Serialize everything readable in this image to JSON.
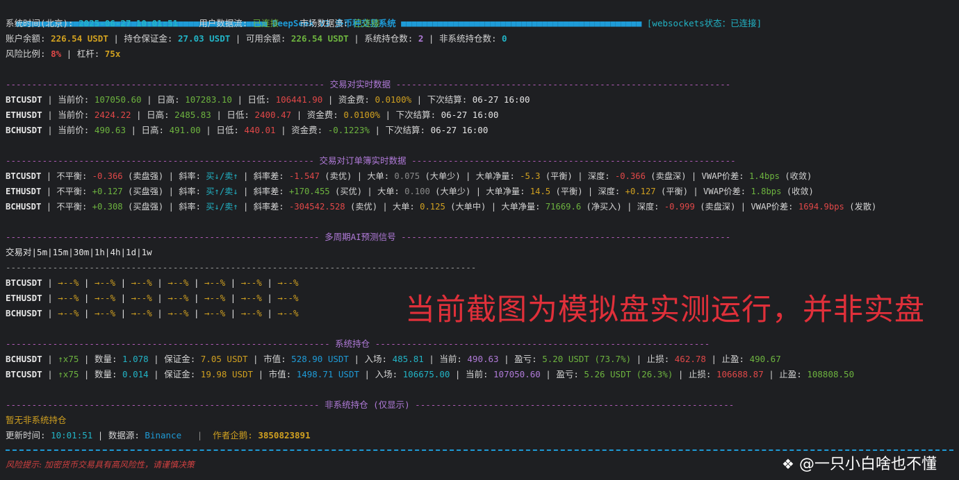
{
  "header": {
    "bar_left": "■■■■■■■■■■■■■■■■■■■■■■■■■■■■■■■■■■■■■■■■■■■■■■■■",
    "title": "DeepSeek V3 多币种交易系统",
    "bar_right": "■■■■■■■■■■■■■■■■■■■■■■■■■■■■■■■■■■■■■■■■■■■■■■",
    "ws_status": "[websockets状态：已连接]"
  },
  "status": {
    "time_label": "系统时间(北京): ",
    "time_value": "2025-06-27 10:01:51",
    "user_label": "用户数据流: ",
    "user_value": "已连接",
    "market_label": "市场数据流: ",
    "market_value": "已连接"
  },
  "account": {
    "balance_label": "账户余额: ",
    "balance": "226.54 USDT",
    "margin_label": " | 持仓保证金: ",
    "margin": "27.03 USDT",
    "avail_label": " | 可用余额: ",
    "avail": "226.54 USDT",
    "sys_label": " | 系统持仓数: ",
    "sys_count": "2",
    "nonsys_label": " | 非系统持仓数: ",
    "nonsys_count": "0",
    "risk_label": "风险比例: ",
    "risk": "8%",
    "lev_label": " | 杠杆: ",
    "lev": "75x"
  },
  "sections": {
    "realtime": "交易对实时数据",
    "orderbook": "交易对订单簿实时数据",
    "ai": "多周期AI预测信号",
    "positions": "系统持仓",
    "nonsys": "非系统持仓 (仅显示)"
  },
  "realtime": [
    {
      "sym": "BTCUSDT",
      "price": "107050.60",
      "high": "107283.10",
      "low": "106441.90",
      "fee": "0.0100%",
      "next": "06-27 16:00"
    },
    {
      "sym": "ETHUSDT",
      "price": "2424.22",
      "high": "2485.83",
      "low": "2400.47",
      "fee": "0.0100%",
      "next": "06-27 16:00"
    },
    {
      "sym": "BCHUSDT",
      "price": "490.63",
      "high": "491.00",
      "low": "440.01",
      "fee": "-0.1223%",
      "next": "06-27 16:00"
    }
  ],
  "realtime_labels": {
    "price": " | 当前价: ",
    "high": " | 日高: ",
    "low": " | 日低: ",
    "fee": " | 资金费: ",
    "next": " | 下次结算: "
  },
  "orderbook": [
    {
      "sym": "BTCUSDT",
      "imb": "-0.366",
      "imb_note": "(卖盘强)",
      "slope": "买↓/卖↑",
      "sdiff": "-1.547",
      "sdiff_note": "(卖优)",
      "big": "0.075",
      "big_note": "(大单少)",
      "net": "-5.3",
      "net_note": "(平衡)",
      "depth": "-0.366",
      "depth_note": "(卖盘深)",
      "vwap": "1.4bps",
      "vwap_note": "(收敛)"
    },
    {
      "sym": "ETHUSDT",
      "imb": "+0.127",
      "imb_note": "(买盘强)",
      "slope": "买↑/卖↓",
      "sdiff": "+170.455",
      "sdiff_note": "(买优)",
      "big": "0.100",
      "big_note": "(大单少)",
      "net": "14.5",
      "net_note": "(平衡)",
      "depth": "+0.127",
      "depth_note": "(平衡)",
      "vwap": "1.8bps",
      "vwap_note": "(收敛)"
    },
    {
      "sym": "BCHUSDT",
      "imb": "+0.308",
      "imb_note": "(买盘强)",
      "slope": "买↓/卖↑",
      "sdiff": "-304542.528",
      "sdiff_note": "(卖优)",
      "big": "0.125",
      "big_note": "(大单中)",
      "net": "71669.6",
      "net_note": "(净买入)",
      "depth": "-0.999",
      "depth_note": "(卖盘深)",
      "vwap": "1694.9bps",
      "vwap_note": "(发散)"
    }
  ],
  "ob_labels": {
    "imb": " | 不平衡: ",
    "slope": " | 斜率: ",
    "sdiff": " | 斜率差: ",
    "big": " | 大单: ",
    "net": " | 大单净量: ",
    "depth": " | 深度: ",
    "vwap": " | VWAP价差: "
  },
  "ai": {
    "header": [
      "交易对",
      "5m",
      "15m",
      "30m",
      "1h",
      "4h",
      "1d",
      "1w"
    ],
    "rows": [
      {
        "sym": "BTCUSDT",
        "cells": [
          "→--%",
          "→--%",
          "→--%",
          "→--%",
          "→--%",
          "→--%",
          "→--%"
        ]
      },
      {
        "sym": "ETHUSDT",
        "cells": [
          "→--%",
          "→--%",
          "→--%",
          "→--%",
          "→--%",
          "→--%",
          "→--%"
        ]
      },
      {
        "sym": "BCHUSDT",
        "cells": [
          "→--%",
          "→--%",
          "→--%",
          "→--%",
          "→--%",
          "→--%",
          "→--%"
        ]
      }
    ]
  },
  "positions": [
    {
      "sym": "BCHUSDT",
      "dir": "↑x75",
      "qty": "1.078",
      "margin": "7.05 USDT",
      "value": "528.90 USDT",
      "entry": "485.81",
      "current": "490.63",
      "pnl": "5.20 USDT (73.7%)",
      "sl": "462.78",
      "tp": "490.67"
    },
    {
      "sym": "BTCUSDT",
      "dir": "↑x75",
      "qty": "0.014",
      "margin": "19.98 USDT",
      "value": "1498.71 USDT",
      "entry": "106675.00",
      "current": "107050.60",
      "pnl": "5.26 USDT (26.3%)",
      "sl": "106688.87",
      "tp": "108808.50"
    }
  ],
  "pos_labels": {
    "qty": " | 数量: ",
    "margin": " | 保证金: ",
    "value": " | 市值: ",
    "entry": " | 入场: ",
    "current": " | 当前: ",
    "pnl": " | 盈亏: ",
    "sl": " | 止损: ",
    "tp": " | 止盈: "
  },
  "nonsys_empty": "暂无非系统持仓",
  "update": {
    "label": "更新时间: ",
    "time": "10:01:51",
    "src_label": " | 数据源: ",
    "src": "Binance",
    "author_label": "作者企鹅: ",
    "author": "3850823891"
  },
  "watermark": "当前截图为模拟盘实测运行，并非实盘",
  "footer_warning": "风险提示: 加密货币交易具有高风险性，请谨慎决策",
  "brand": "@一只小白啥也不懂"
}
